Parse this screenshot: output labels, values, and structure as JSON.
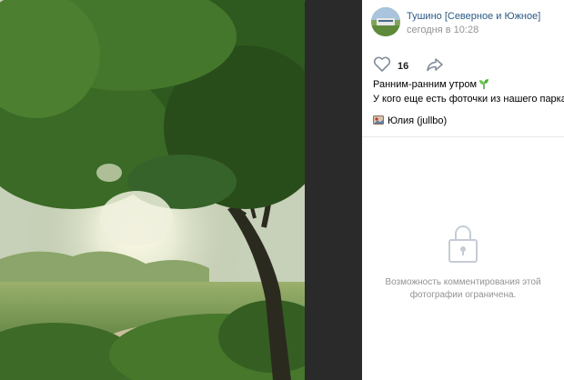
{
  "post": {
    "author_name": "Тушино [Северное и Южное]",
    "time": "сегодня в 10:28",
    "likes": "16",
    "caption_line1": "Ранним-ранним утром",
    "caption_line2": "У кого еще есть фоточки из нашего парка?",
    "tagged_person": "Юлия (jullbo)"
  },
  "comments": {
    "closed_message": "Возможность комментирования этой фотографии ограничена."
  },
  "icons": {
    "like": "heart-outline-icon",
    "share": "share-arrow-icon",
    "sprout": "sprout-emoji-icon",
    "tag": "photo-tag-icon",
    "lock": "lock-outline-icon"
  },
  "colors": {
    "link": "#2a5885",
    "muted": "#939393",
    "viewer_background": "#2a2a2a"
  }
}
